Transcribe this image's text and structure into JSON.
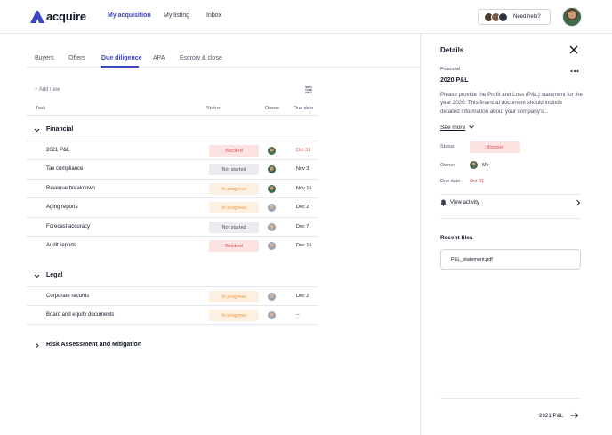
{
  "brand": {
    "name": "acquire",
    "color": "#3b46c4"
  },
  "nav": {
    "items": [
      {
        "label": "My acquisition",
        "active": true
      },
      {
        "label": "My listing",
        "active": false
      },
      {
        "label": "Inbox",
        "active": false
      }
    ],
    "help_label": "Need help?"
  },
  "tabs": [
    {
      "label": "Buyers",
      "active": false
    },
    {
      "label": "Offers",
      "active": false
    },
    {
      "label": "Due diligence",
      "active": true
    },
    {
      "label": "APA",
      "active": false
    },
    {
      "label": "Escrow & close",
      "active": false
    }
  ],
  "toolbar": {
    "add_new": "+ Add new",
    "filter_icon": "filter-icon"
  },
  "table": {
    "headers": {
      "task": "Task",
      "status": "Status",
      "owner": "Owner",
      "due": "Due date"
    },
    "groups": [
      {
        "title": "Financial",
        "expanded": true,
        "rows": [
          {
            "task": "2021 P&L",
            "status": "Blocked",
            "status_type": "blocked",
            "owner": "green",
            "due": "Oct 31",
            "overdue": true
          },
          {
            "task": "Tax compliance",
            "status": "Not started",
            "status_type": "notstarted",
            "owner": "green",
            "due": "Nov 3",
            "overdue": false
          },
          {
            "task": "Revenue breakdown",
            "status": "In progress",
            "status_type": "inprogress",
            "owner": "green",
            "due": "Nov 16",
            "overdue": false
          },
          {
            "task": "Aging reports",
            "status": "In progress",
            "status_type": "inprogress",
            "owner": "gray",
            "due": "Dec 2",
            "overdue": false
          },
          {
            "task": "Forecast accuracy",
            "status": "Not started",
            "status_type": "notstarted",
            "owner": "gray",
            "due": "Dec 7",
            "overdue": false
          },
          {
            "task": "Audit reports",
            "status": "Blocked",
            "status_type": "blocked",
            "owner": "gray",
            "due": "Dec 16",
            "overdue": false
          }
        ]
      },
      {
        "title": "Legal",
        "expanded": true,
        "rows": [
          {
            "task": "Corporate records",
            "status": "In progress",
            "status_type": "inprogress",
            "owner": "gray",
            "due": "Dec 2",
            "overdue": false
          },
          {
            "task": "Board and equity documents",
            "status": "In progress",
            "status_type": "inprogress",
            "owner": "gray",
            "due": "--",
            "overdue": false
          }
        ]
      },
      {
        "title": "Risk Assessment and Mitigation",
        "expanded": false,
        "rows": []
      }
    ]
  },
  "details": {
    "title": "Details",
    "category": "Financial",
    "item_title": "2020 P&L",
    "description": "Please provide the Profit and Loss (P&L) statement for the year 2020. This financial document should include detailed information about your company's...",
    "see_more": "See more",
    "status_label": "Status",
    "status_value": "Blocked",
    "owner_label": "Owner",
    "owner_value": "Me",
    "due_label": "Due date",
    "due_value": "Oct 31",
    "view_activity": "View activity",
    "recent_files_title": "Recent files",
    "files": [
      "P&L_statement.pdf"
    ],
    "next_item": "2021 P&L"
  },
  "colors": {
    "blocked_bg": "#fde2e2",
    "blocked_text": "#e05252",
    "notstarted_bg": "#ececf0",
    "inprogress_bg": "#fdf0e0",
    "inprogress_text": "#e69a3c"
  }
}
